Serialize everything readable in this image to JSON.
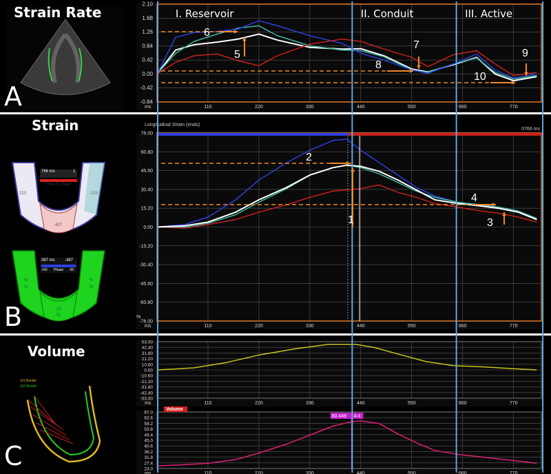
{
  "panels": {
    "a": {
      "letter": "A",
      "title": "Strain Rate"
    },
    "b": {
      "letter": "B",
      "title": "Strain"
    },
    "c": {
      "letter": "C",
      "title": "Volume"
    }
  },
  "phases": [
    "I. Reservoir",
    "II. Conduit",
    "III. Active"
  ],
  "colors": {
    "grid": "#5a5a5a",
    "phase_line": "#5fa8e0",
    "frame": "#e07a2a",
    "white": "#ffffff",
    "teal": "#3fb7a4",
    "blue": "#2b3fe0",
    "red": "#c8201c",
    "yellow": "#c8c41e",
    "magenta": "#e01e78",
    "annot": "#f08a2a"
  },
  "chart_data": [
    {
      "id": "strain-rate",
      "type": "line",
      "title": "Strain Rate",
      "xlabel": "ms",
      "ylabel": "",
      "xlim": [
        0,
        830
      ],
      "ylim": [
        -0.84,
        2.1
      ],
      "x_ticks": [
        110,
        220,
        330,
        440,
        550,
        660,
        770
      ],
      "y_ticks": [
        "2.10",
        "1.68",
        "1.26",
        "0.84",
        "0.42",
        "0.00",
        "-0.42",
        "-0.84"
      ],
      "series": [
        {
          "color": "white",
          "x": [
            0,
            40,
            80,
            130,
            175,
            220,
            260,
            330,
            400,
            440,
            490,
            550,
            585,
            640,
            690,
            730,
            770,
            820
          ],
          "y": [
            0,
            0.72,
            0.88,
            0.96,
            1.05,
            1.2,
            1.02,
            0.8,
            0.75,
            0.76,
            0.55,
            0.15,
            0.06,
            0.28,
            0.5,
            0.0,
            -0.2,
            -0.08
          ]
        },
        {
          "color": "teal",
          "x": [
            0,
            40,
            80,
            130,
            175,
            220,
            260,
            330,
            400,
            440,
            490,
            550,
            585,
            640,
            690,
            730,
            770,
            820
          ],
          "y": [
            0,
            0.62,
            0.98,
            1.2,
            1.38,
            1.45,
            1.15,
            0.85,
            0.72,
            0.7,
            0.52,
            0.12,
            0.05,
            0.3,
            0.48,
            0.05,
            -0.15,
            -0.05
          ]
        },
        {
          "color": "blue",
          "x": [
            0,
            40,
            80,
            130,
            175,
            220,
            260,
            330,
            400,
            440,
            490,
            550,
            585,
            640,
            690,
            730,
            770,
            820
          ],
          "y": [
            0,
            1.1,
            1.25,
            1.28,
            1.35,
            1.6,
            1.45,
            1.15,
            0.92,
            0.62,
            0.42,
            0.12,
            0.02,
            0.3,
            0.6,
            0.12,
            -0.12,
            0.0
          ]
        },
        {
          "color": "red",
          "x": [
            0,
            40,
            80,
            130,
            175,
            220,
            260,
            330,
            400,
            440,
            490,
            550,
            585,
            640,
            690,
            730,
            770,
            820
          ],
          "y": [
            0,
            0.35,
            0.55,
            0.6,
            0.4,
            0.25,
            0.55,
            0.9,
            1.05,
            0.98,
            0.75,
            0.5,
            0.22,
            0.58,
            0.7,
            0.3,
            -0.05,
            0.05
          ]
        }
      ],
      "annotations": [
        "5",
        "6",
        "7",
        "8",
        "9",
        "10"
      ]
    },
    {
      "id": "strain",
      "type": "line",
      "title": "Longitudinal Strain (endo)",
      "xlabel": "ms",
      "ylabel": "%",
      "time_marker": "0766 ms",
      "xlim": [
        0,
        830
      ],
      "ylim": [
        -76,
        76
      ],
      "x_ticks": [
        110,
        220,
        330,
        440,
        550,
        660,
        770
      ],
      "y_ticks": [
        "76.00",
        "60.80",
        "45.60",
        "30.40",
        "15.20",
        "0.00",
        "-15.20",
        "-30.40",
        "-45.60",
        "-60.80",
        "-76.00"
      ],
      "series": [
        {
          "color": "white",
          "x": [
            0,
            60,
            110,
            170,
            220,
            280,
            330,
            380,
            410,
            440,
            480,
            520,
            560,
            600,
            650,
            700,
            740,
            780,
            820
          ],
          "y": [
            0,
            1,
            4,
            12,
            22,
            32,
            42,
            48,
            50,
            49,
            45,
            38,
            30,
            22,
            19,
            17,
            15,
            12,
            6
          ]
        },
        {
          "color": "teal",
          "x": [
            0,
            60,
            110,
            170,
            220,
            280,
            330,
            380,
            410,
            440,
            480,
            520,
            560,
            600,
            650,
            700,
            740,
            780,
            820
          ],
          "y": [
            0,
            0,
            3,
            10,
            20,
            31,
            42,
            48,
            50,
            48,
            43,
            36,
            29,
            24,
            20,
            18,
            16,
            13,
            7
          ]
        },
        {
          "color": "blue",
          "x": [
            0,
            60,
            110,
            170,
            220,
            280,
            330,
            380,
            410,
            440,
            480,
            520,
            560,
            600,
            650,
            700,
            740,
            780,
            820
          ],
          "y": [
            0,
            2,
            8,
            22,
            38,
            52,
            62,
            70,
            71,
            62,
            52,
            42,
            32,
            25,
            20,
            17,
            15,
            12,
            6
          ]
        },
        {
          "color": "red",
          "x": [
            0,
            60,
            110,
            170,
            220,
            280,
            330,
            380,
            410,
            440,
            480,
            520,
            560,
            600,
            650,
            700,
            740,
            780,
            820
          ],
          "y": [
            0,
            -1,
            2,
            6,
            12,
            18,
            24,
            29,
            30,
            31,
            34,
            28,
            24,
            19,
            16,
            13,
            11,
            8,
            4
          ]
        }
      ],
      "annotations": [
        "1",
        "2",
        "3",
        "4"
      ]
    },
    {
      "id": "volume-rate",
      "type": "line",
      "xlabel": "ms",
      "xlim": [
        0,
        830
      ],
      "ylim": [
        -53,
        53
      ],
      "x_ticks": [
        110,
        220,
        330,
        440,
        550,
        660,
        770
      ],
      "y_ticks": [
        "53.00",
        "42.40",
        "31.80",
        "21.20",
        "10.60",
        "0.00",
        "-10.60",
        "-21.20",
        "-31.80",
        "-42.40",
        "-53.00"
      ],
      "series": [
        {
          "color": "yellow",
          "x": [
            0,
            80,
            150,
            220,
            300,
            370,
            430,
            470,
            520,
            580,
            640,
            700,
            760,
            820
          ],
          "y": [
            0,
            4,
            14,
            28,
            40,
            48,
            48,
            42,
            30,
            16,
            8,
            6,
            3,
            0
          ]
        }
      ]
    },
    {
      "id": "volume",
      "type": "line",
      "title": "Volume",
      "marker_value": "60.449",
      "marker_time": "4:4",
      "xlabel": "ms",
      "xlim": [
        0,
        830
      ],
      "ylim": [
        23.0,
        67.0
      ],
      "x_ticks": [
        110,
        220,
        330,
        440,
        550,
        660,
        770
      ],
      "y_ticks": [
        "67.0",
        "62.6",
        "58.2",
        "53.8",
        "49.4",
        "45.0",
        "40.6",
        "36.2",
        "31.8",
        "27.4",
        "23.0"
      ],
      "series": [
        {
          "color": "magenta",
          "x": [
            0,
            60,
            110,
            170,
            220,
            280,
            330,
            380,
            420,
            440,
            480,
            520,
            560,
            600,
            650,
            700,
            750,
            800,
            820
          ],
          "y": [
            25,
            26,
            27,
            30,
            35,
            42,
            49,
            56,
            59.5,
            60,
            58,
            50,
            43,
            37,
            34,
            32,
            30,
            28,
            27
          ]
        }
      ]
    }
  ],
  "left_images": {
    "b_top": {
      "time": "766 ms",
      "value": "1",
      "label": "Time To Peak",
      "left_val": "223",
      "right_val": "223",
      "bottom_val": "-427"
    },
    "b_bottom": {
      "time": "387 ms",
      "value": "-387",
      "scale_left": "+50",
      "scale_mid": "Phase",
      "scale_right": "-50",
      "left_a": "%",
      "left_b": "%",
      "right_a": "%",
      "right_b": "%",
      "bottom_a": "22",
      "bottom_b": "%"
    },
    "c": {
      "legend_a": "ES Border",
      "legend_b": "ED Border"
    }
  }
}
